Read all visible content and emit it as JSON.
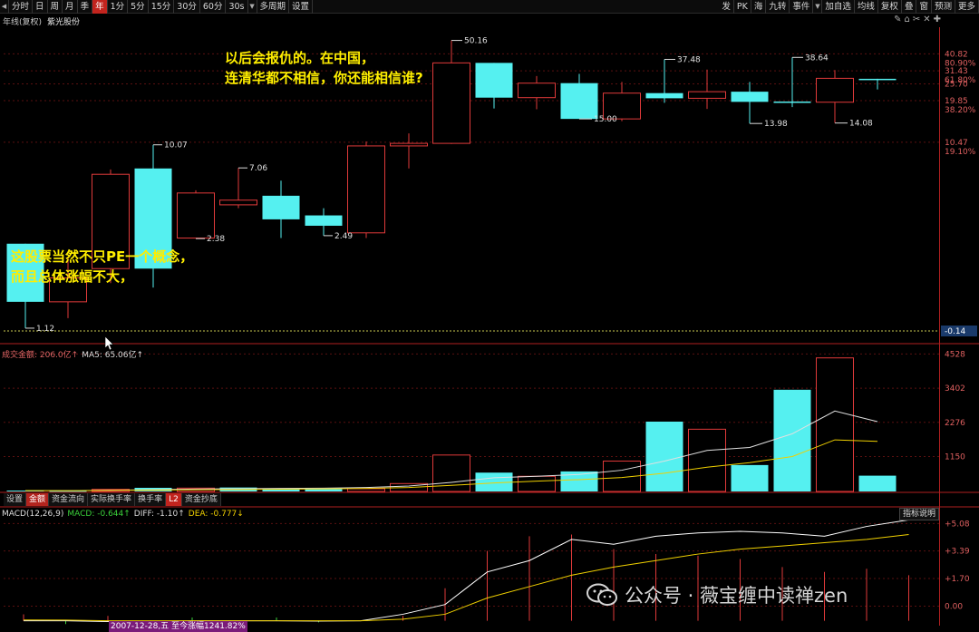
{
  "toolbar": {
    "left_items": [
      "分时",
      "日",
      "周",
      "月",
      "季",
      "年",
      "1分",
      "5分",
      "15分",
      "30分",
      "60分",
      "30s",
      "多周期",
      "设置"
    ],
    "active_item": "年",
    "right_items": [
      "发",
      "PK",
      "海",
      "九转",
      "事件",
      "加自选",
      "均线",
      "复权",
      "叠",
      "窗",
      "预测",
      "更多"
    ],
    "right_icons": [
      "✎",
      "⌂",
      "✂",
      "✕",
      "✚"
    ]
  },
  "info": {
    "period_label": "年线(复权)",
    "stock_name": "紫光股份"
  },
  "annotations": {
    "top_line1": "以后会报仇的。在中国，",
    "top_line2": "连清华都不相信，你还能相信谁?",
    "left_line1": "这股票当然不只PE一个概念，",
    "left_line2": "而且总体涨幅不大，"
  },
  "price_axis": {
    "ticks": [
      {
        "price": "40.82",
        "pct": "80.90%"
      },
      {
        "price": "31.43",
        "pct": "61.80%"
      },
      {
        "price": "25.70",
        "pct": ""
      },
      {
        "price": "19.85",
        "pct": "38.20%"
      },
      {
        "price": "10.47",
        "pct": "19.10%"
      }
    ],
    "current": "-0.14"
  },
  "volume_panel": {
    "label": "成交金额: 206.0亿↑",
    "ma_label": "MA5: 65.06亿↑",
    "ticks": [
      "4528",
      "3402",
      "2276",
      "1150"
    ]
  },
  "tabs": [
    "设置",
    "金额",
    "资金流向",
    "实际换手率",
    "换手率",
    "L2",
    "资金抄底"
  ],
  "active_tab": "金额",
  "macd": {
    "name": "MACD(12,26,9)",
    "macd": "MACD: -0.644↑",
    "diff": "DIFF: -1.10↑",
    "dea": "DEA: -0.777↓",
    "help": "指标说明",
    "ticks": [
      "+5.08",
      "+3.39",
      "+1.70",
      "0.00"
    ]
  },
  "date_badge": "2007-12-28,五 至今涨幅1241.82%",
  "watermark": "公众号 · 薇宝缠中读禅zen",
  "colors": {
    "up": "#e03a3a",
    "down": "#55f0f0",
    "annotation": "#ffee00",
    "diff_line": "#ffffff",
    "dea_line": "#f0d000"
  },
  "chart_data": {
    "type": "candlestick",
    "title": "",
    "labeled_prices": {
      "high_1": "50.16",
      "high_2": "37.48",
      "high_3": "38.64",
      "low_1": "15.00",
      "low_2": "13.98",
      "low_3": "14.08",
      "early_1": "10.07",
      "early_2": "7.06",
      "early_3": "2.38",
      "early_4": "2.49",
      "early_5": "1.12"
    },
    "candles": [
      {
        "dir": "down",
        "open": 2.2,
        "close": 0.9,
        "high": 2.2,
        "low": 0.6
      },
      {
        "dir": "up",
        "open": 0.9,
        "close": 1.3,
        "high": 1.8,
        "low": 0.7
      },
      {
        "dir": "up",
        "open": 1.5,
        "close": 6.4,
        "high": 6.9,
        "low": 1.2
      },
      {
        "dir": "down",
        "open": 7.0,
        "close": 1.5,
        "high": 10.07,
        "low": 1.12
      },
      {
        "dir": "up",
        "open": 2.4,
        "close": 4.8,
        "high": 5.0,
        "low": 2.38
      },
      {
        "dir": "up",
        "open": 4.0,
        "close": 4.3,
        "high": 7.06,
        "low": 3.8
      },
      {
        "dir": "down",
        "open": 4.6,
        "close": 3.2,
        "high": 5.8,
        "low": 2.4
      },
      {
        "dir": "down",
        "open": 3.4,
        "close": 2.9,
        "high": 3.8,
        "low": 2.49
      },
      {
        "dir": "up",
        "open": 2.6,
        "close": 9.9,
        "high": 10.6,
        "low": 2.4
      },
      {
        "dir": "up",
        "open": 9.9,
        "close": 10.3,
        "high": 12.0,
        "low": 7.0
      },
      {
        "dir": "up",
        "open": 10.3,
        "close": 35.5,
        "high": 50.16,
        "low": 10.2
      },
      {
        "dir": "down",
        "open": 35.5,
        "close": 20.8,
        "high": 35.5,
        "low": 17.6
      },
      {
        "dir": "up",
        "open": 20.8,
        "close": 26.0,
        "high": 29.0,
        "low": 17.4
      },
      {
        "dir": "down",
        "open": 26.0,
        "close": 15.0,
        "high": 30.0,
        "low": 15.0
      },
      {
        "dir": "up",
        "open": 15.0,
        "close": 22.3,
        "high": 26.5,
        "low": 14.5
      },
      {
        "dir": "down",
        "open": 22.3,
        "close": 20.6,
        "high": 37.48,
        "low": 19.2
      },
      {
        "dir": "up",
        "open": 20.6,
        "close": 22.8,
        "high": 32.0,
        "low": 17.5
      },
      {
        "dir": "down",
        "open": 22.8,
        "close": 19.5,
        "high": 26.5,
        "low": 13.98
      },
      {
        "dir": "down",
        "open": 19.6,
        "close": 19.4,
        "high": 38.64,
        "low": 18.0
      },
      {
        "dir": "up",
        "open": 19.4,
        "close": 28.0,
        "high": 31.8,
        "low": 14.08
      },
      {
        "dir": "down",
        "open": 27.8,
        "close": 27.6,
        "high": 27.8,
        "low": 23.6
      }
    ],
    "volume": [
      {
        "dir": "down",
        "value": 30
      },
      {
        "dir": "down",
        "value": 20
      },
      {
        "dir": "up",
        "value": 70
      },
      {
        "dir": "down",
        "value": 120
      },
      {
        "dir": "up",
        "value": 110
      },
      {
        "dir": "down",
        "value": 130
      },
      {
        "dir": "down",
        "value": 90
      },
      {
        "dir": "down",
        "value": 80
      },
      {
        "dir": "up",
        "value": 90
      },
      {
        "dir": "up",
        "value": 260
      },
      {
        "dir": "up",
        "value": 1200
      },
      {
        "dir": "down",
        "value": 620
      },
      {
        "dir": "up",
        "value": 500
      },
      {
        "dir": "down",
        "value": 660
      },
      {
        "dir": "up",
        "value": 1000
      },
      {
        "dir": "down",
        "value": 2300
      },
      {
        "dir": "up",
        "value": 2050
      },
      {
        "dir": "down",
        "value": 870
      },
      {
        "dir": "down",
        "value": 3350
      },
      {
        "dir": "up",
        "value": 4400
      },
      {
        "dir": "down",
        "value": 520
      }
    ],
    "vol_ma_white": [
      30,
      25,
      40,
      60,
      80,
      90,
      100,
      110,
      130,
      180,
      300,
      450,
      500,
      560,
      700,
      1000,
      1350,
      1450,
      1900,
      2650,
      2300
    ],
    "vol_ma_yellow": [
      30,
      28,
      35,
      45,
      55,
      65,
      75,
      85,
      100,
      130,
      200,
      280,
      340,
      390,
      460,
      600,
      800,
      950,
      1150,
      1700,
      1650
    ],
    "macd_diff": [
      -0.9,
      -0.9,
      -0.95,
      -0.95,
      -0.9,
      -0.9,
      -0.9,
      -0.92,
      -0.9,
      -0.5,
      0.1,
      2.1,
      2.8,
      4.1,
      3.8,
      4.3,
      4.5,
      4.6,
      4.5,
      4.3,
      4.9,
      5.3
    ],
    "macd_dea": [
      -0.85,
      -0.86,
      -0.9,
      -0.9,
      -0.9,
      -0.9,
      -0.9,
      -0.9,
      -0.9,
      -0.8,
      -0.5,
      0.5,
      1.2,
      1.9,
      2.4,
      2.8,
      3.2,
      3.5,
      3.7,
      3.9,
      4.1,
      4.4
    ],
    "macd_hist": [
      0.4,
      -0.2,
      0.3,
      -0.2,
      0.2,
      -0.1,
      0.2,
      -0.1,
      0.0,
      0.3,
      2.0,
      4.3,
      5.2,
      5.3,
      4.4,
      4.1,
      4.0,
      3.8,
      3.3,
      3.0,
      3.2,
      2.8
    ]
  }
}
